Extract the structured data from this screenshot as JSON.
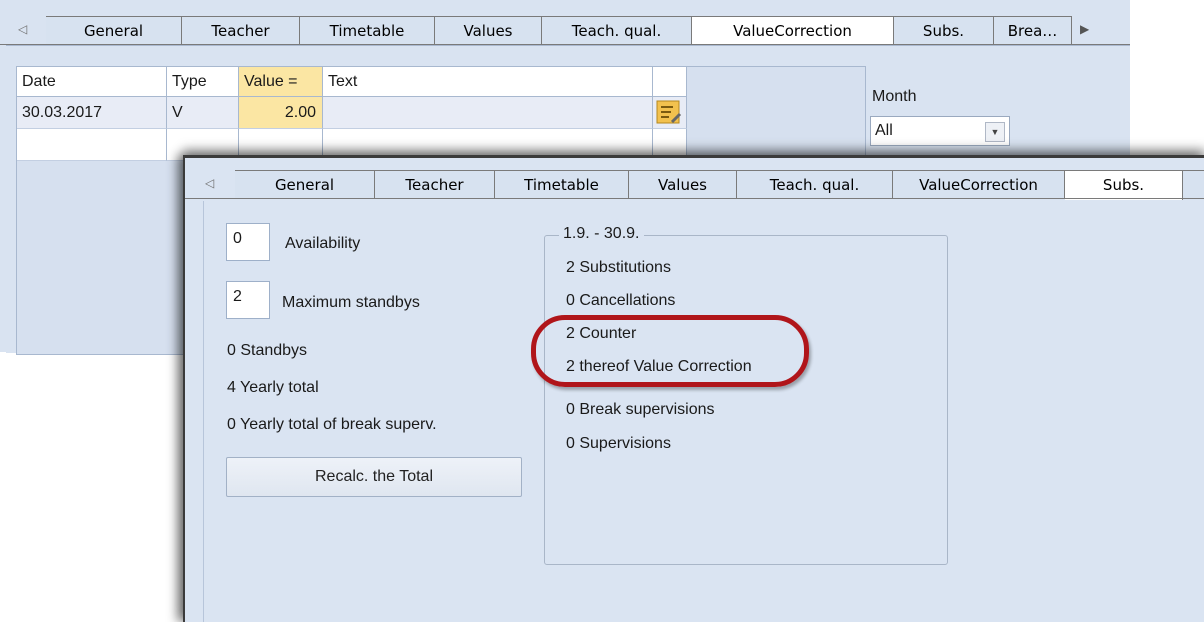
{
  "background_window": {
    "tabs": [
      "General",
      "Teacher",
      "Timetable",
      "Values",
      "Teach. qual.",
      "ValueCorrection",
      "Subs.",
      "Brea…"
    ],
    "active_tab": "ValueCorrection",
    "grid": {
      "headers": [
        "Date",
        "Type",
        "Value =",
        "Text"
      ],
      "rows": [
        {
          "date": "30.03.2017",
          "type": "V",
          "value": "2.00",
          "text": ""
        }
      ]
    },
    "month_label": "Month",
    "month_value": "All"
  },
  "foreground_window": {
    "tabs": [
      "General",
      "Teacher",
      "Timetable",
      "Values",
      "Teach. qual.",
      "ValueCorrection",
      "Subs."
    ],
    "active_tab": "Subs.",
    "availability_value": "0",
    "availability_label": "Availability",
    "max_standbys_value": "2",
    "max_standbys_label": "Maximum standbys",
    "standbys": "0 Standbys",
    "yearly_total": "4 Yearly total",
    "yearly_break": "0  Yearly total of break superv.",
    "recalc_label": "Recalc. the Total",
    "period_group": {
      "title": "1.9. - 30.9.",
      "substitutions": "2 Substitutions",
      "cancellations": "0 Cancellations",
      "counter": "2 Counter",
      "thereof_value_correction": "2 thereof Value Correction",
      "break_supervisions": "0 Break supervisions",
      "supervisions": "0 Supervisions"
    }
  },
  "colors": {
    "highlight": "#b0151a",
    "value_cell": "#fbe6a3",
    "panel_bg": "#dae4f2"
  }
}
